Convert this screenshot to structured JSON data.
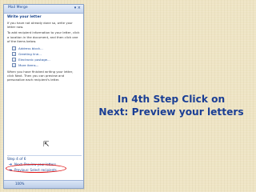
{
  "task_pane": {
    "title": "Mail Merge",
    "section_title": "Write your letter",
    "intro_text": "If you have not already done so, write your letter now.",
    "instructions": "To add recipient information to your letter, click a location in the document, and then click one of the items below.",
    "items": [
      {
        "label": "Address block...",
        "icon": "address-block-icon"
      },
      {
        "label": "Greeting line...",
        "icon": "greeting-line-icon"
      },
      {
        "label": "Electronic postage...",
        "icon": "electronic-postage-icon"
      },
      {
        "label": "More items...",
        "icon": "more-items-icon"
      }
    ],
    "finish_text": "When you have finished writing your letter, click Next. Then you can preview and personalize each recipient's letter.",
    "step_label": "Step 4 of 6",
    "next_link": "Next: Preview your letters",
    "previous_link": "Previous: Select recipients",
    "zoom": "100%"
  },
  "overlay": {
    "line1": "In 4th Step Click on",
    "line2": "Next: Preview your letters"
  },
  "colors": {
    "background": "#eee4c4",
    "instruction_text": "#1a3e95",
    "highlight": "#e01818"
  }
}
